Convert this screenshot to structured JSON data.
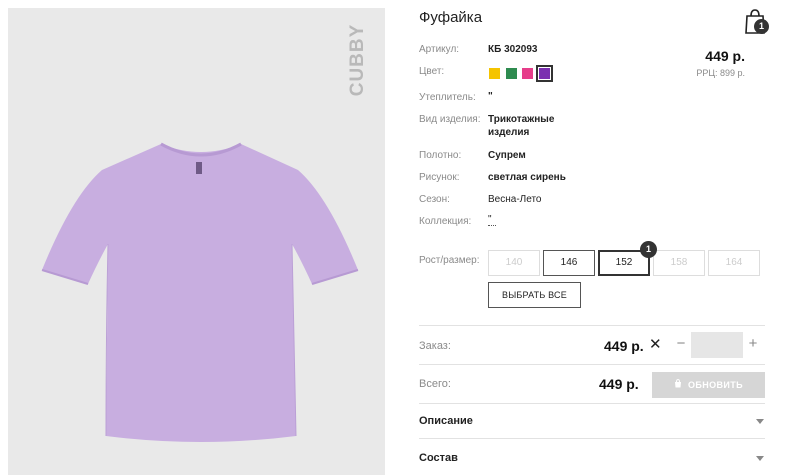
{
  "product": {
    "title": "Фуфайка",
    "brand_logo": "CUBBY",
    "price": "449 р.",
    "rrp": "РРЦ: 899 р."
  },
  "cart": {
    "icon": "shopping-bag-icon",
    "count": "1"
  },
  "details": {
    "article_label": "Артикул:",
    "article_value": "КБ 302093",
    "color_label": "Цвет:",
    "insulation_label": "Утеплитель:",
    "insulation_value": "\"",
    "type_label": "Вид изделия:",
    "type_value": "Трикотажные изделия",
    "fabric_label": "Полотно:",
    "fabric_value": "Супрем",
    "pattern_label": "Рисунок:",
    "pattern_value": "светлая сирень",
    "season_label": "Сезон:",
    "season_value": "Весна-Лето",
    "collection_label": "Коллекция:",
    "collection_value": "\""
  },
  "colors": [
    {
      "hex": "#f5c400",
      "selected": false
    },
    {
      "hex": "#2e8b4f",
      "selected": false
    },
    {
      "hex": "#e63d8a",
      "selected": false
    },
    {
      "hex": "#7b2fb0",
      "selected": true
    }
  ],
  "sizes": {
    "label": "Рост/размер:",
    "items": [
      {
        "label": "140",
        "state": "unavailable"
      },
      {
        "label": "146",
        "state": "available"
      },
      {
        "label": "152",
        "state": "selected",
        "badge": "1"
      },
      {
        "label": "158",
        "state": "unavailable"
      },
      {
        "label": "164",
        "state": "unavailable"
      }
    ],
    "select_all": "ВЫБРАТЬ ВСЕ"
  },
  "order": {
    "label": "Заказ:",
    "price": "449 р.",
    "quantity": ""
  },
  "total": {
    "label": "Всего:",
    "price": "449 р.",
    "update_label": "ОБНОВИТЬ"
  },
  "accordions": {
    "description": "Описание",
    "composition": "Состав"
  },
  "colors_theme": {
    "accent_dark": "#333333",
    "muted": "#8a8a8a",
    "disabled_button": "#d6d6d6",
    "shirt": "#c8aee0"
  }
}
